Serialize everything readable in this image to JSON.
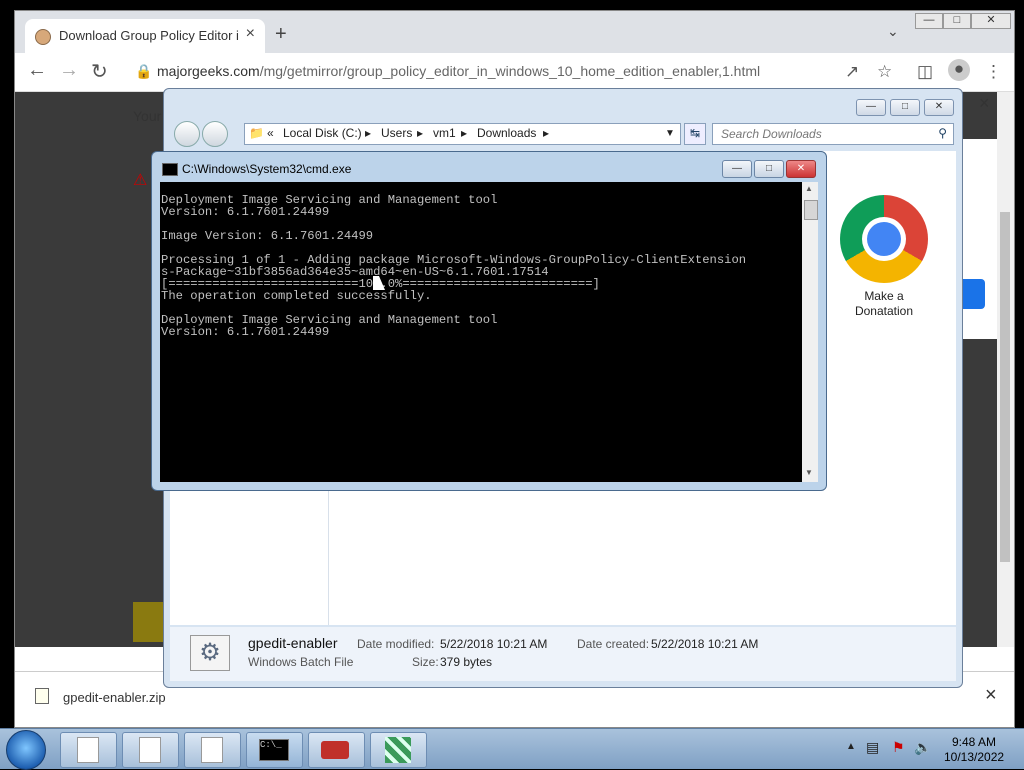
{
  "browser": {
    "tab_title": "Download Group Policy Editor in",
    "tab_close": "×",
    "new_tab": "+",
    "url_host": "majorgeeks.com",
    "url_path": "/mg/getmirror/group_policy_editor_in_windows_10_home_edition_enabler,1.html",
    "page_text_your": "Your",
    "page_left_edge_text": "M",
    "donation_label_line1": "Make a",
    "donation_label_line2": "Donatation",
    "download_file": "gpedit-enabler.zip",
    "close_x": "×"
  },
  "explorer": {
    "address_crumbs": [
      "«",
      "Local Disk (C:)",
      "▸",
      "Users",
      "▸",
      "vm1",
      "▸",
      "Downloads",
      "▸"
    ],
    "search_placeholder": "Search Downloads",
    "details": {
      "file_name": "gpedit-enabler",
      "file_type": "Windows Batch File",
      "date_modified_label": "Date modified:",
      "date_modified": "5/22/2018 10:21 AM",
      "date_created_label": "Date created:",
      "date_created": "5/22/2018 10:21 AM",
      "size_label": "Size:",
      "size": "379 bytes"
    }
  },
  "cmd": {
    "title": "C:\\Windows\\System32\\cmd.exe",
    "output": "Deployment Image Servicing and Management tool\nVersion: 6.1.7601.24499\n\nImage Version: 6.1.7601.24499\n\nProcessing 1 of 1 - Adding package Microsoft-Windows-GroupPolicy-ClientExtension\ns-Package~31bf3856ad364e35~amd64~en-US~6.1.7601.17514\n[==========================100.0%==========================]\nThe operation completed successfully.\n\nDeployment Image Servicing and Management tool\nVersion: 6.1.7601.24499"
  },
  "taskbar": {
    "time": "9:48 AM",
    "date": "10/13/2022"
  }
}
